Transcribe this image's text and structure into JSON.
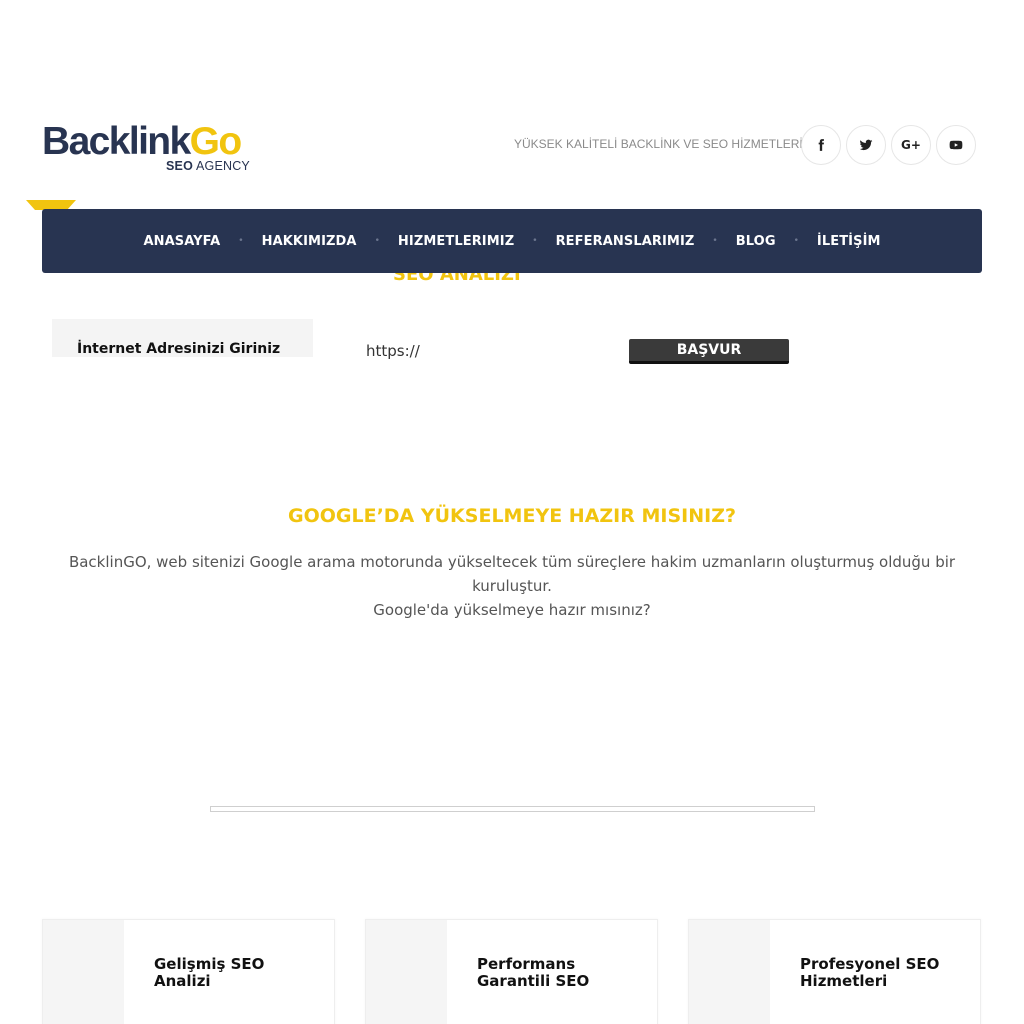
{
  "logo": {
    "text_dark": "Backlink",
    "text_gold": "Go",
    "sub_bold": "SEO",
    "sub_rest": "AGENCY"
  },
  "header": {
    "tagline": "YÜKSEK KALİTELİ BACKLİNK VE SEO HİZMETLERİ",
    "social": [
      {
        "name": "facebook-icon"
      },
      {
        "name": "twitter-icon"
      },
      {
        "name": "google-plus-icon",
        "label": "G+"
      },
      {
        "name": "youtube-icon"
      }
    ]
  },
  "nav": {
    "items": [
      {
        "label": "ANASAYFA"
      },
      {
        "label": "HAKKIMIZDA"
      },
      {
        "label": "HIZMETLERIMIZ"
      },
      {
        "label": "REFERANSLARIMIZ"
      },
      {
        "label": "BLOG"
      },
      {
        "label": "İLETİŞİM"
      }
    ],
    "separator": "•"
  },
  "seo_form": {
    "title": "SEO ANALİZİ",
    "url_label": "İnternet Adresinizi Giriniz",
    "url_value": "https://",
    "submit_label": "BAŞVUR"
  },
  "hero": {
    "title": "GOOGLE’DA YÜKSELMEYE HAZIR MISINIZ?",
    "line1": "BacklinGO, web sitenizi Google arama motorunda yükseltecek tüm süreçlere hakim uzmanların oluşturmuş olduğu bir kuruluştur.",
    "line2": "Google'da yükselmeye hazır mısınız?"
  },
  "cards": [
    {
      "title": "Gelişmiş SEO Analizi"
    },
    {
      "title": "Performans Garantili SEO"
    },
    {
      "title": "Profesyonel SEO Hizmetleri"
    }
  ],
  "colors": {
    "navy": "#283451",
    "gold": "#f1c40f"
  }
}
